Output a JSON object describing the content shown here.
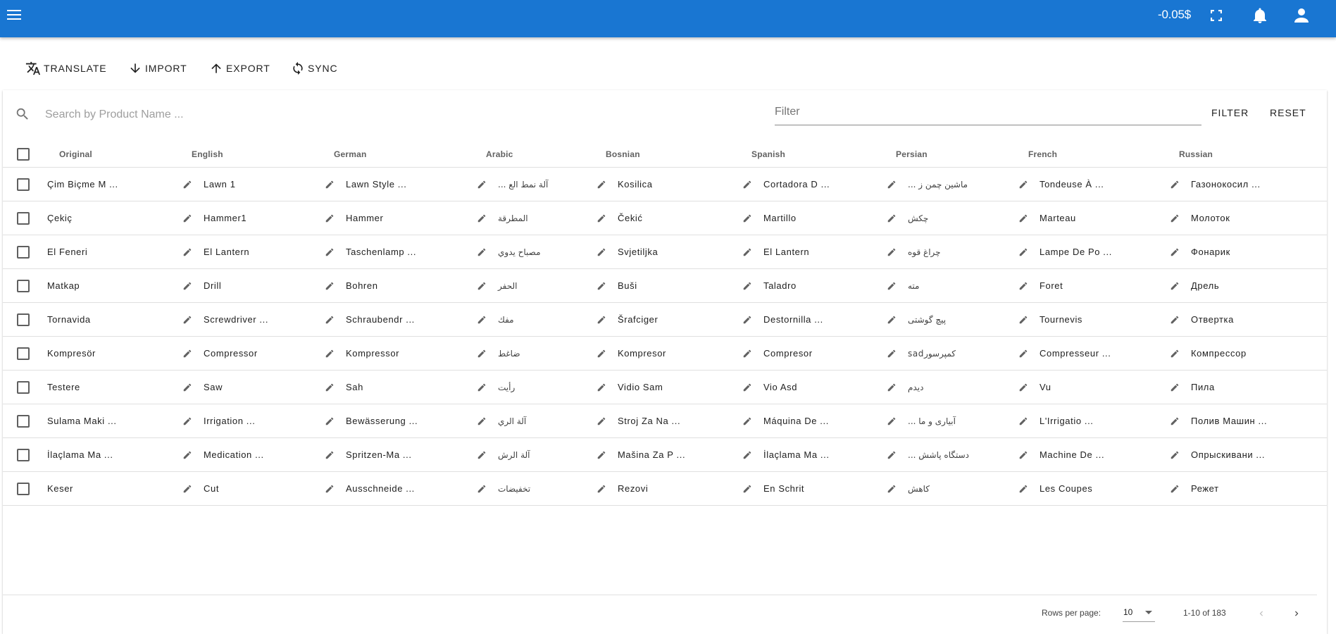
{
  "appbar": {
    "balance": "-0.05$",
    "bg_color": "#1976d2",
    "icons": [
      "menu-icon",
      "fullscreen-icon",
      "bell-icon",
      "account-icon"
    ]
  },
  "toolbar": {
    "translate_label": "TRANSLATE",
    "import_label": "IMPORT",
    "export_label": "EXPORT",
    "sync_label": "SYNC"
  },
  "search": {
    "placeholder": "Search by Product Name ...",
    "value": ""
  },
  "filter": {
    "placeholder": "Filter",
    "value": "",
    "filter_label": "FILTER",
    "reset_label": "RESET"
  },
  "table": {
    "columns": [
      "Original",
      "English",
      "German",
      "Arabic",
      "Bosnian",
      "Spanish",
      "Persian",
      "French",
      "Russian"
    ],
    "rows": [
      [
        "Çim Biçme M ...",
        "Lawn 1",
        "Lawn Style ...",
        "آلة نمط الع ...",
        "Kosilica",
        "Cortadora D ...",
        "ماشین چمن ز ...",
        "Tondeuse À ...",
        "Газонокосил ..."
      ],
      [
        "Çekiç",
        "Hammer1",
        "Hammer",
        "المطرقة",
        "Čekić",
        "Martillo",
        "چکش",
        "Marteau",
        "Молоток"
      ],
      [
        "El Feneri",
        "El Lantern",
        "Taschenlamp ...",
        "مصباح يدوي",
        "Svjetiljka",
        "El Lantern",
        "چراغ قوه",
        "Lampe De Po ...",
        "Фонарик"
      ],
      [
        "Matkap",
        "Drill",
        "Bohren",
        "الحفر",
        "Buši",
        "Taladro",
        "مته",
        "Foret",
        "Дрель"
      ],
      [
        "Tornavida",
        "Screwdriver ...",
        "Schraubendr ...",
        "مفك",
        "Šrafciger",
        "Destornilla ...",
        "پیچ گوشتی",
        "Tournevis",
        "Отвертка"
      ],
      [
        "Kompresör",
        "Compressor",
        "Kompressor",
        "ضاغط",
        "Kompresor",
        "Compresor",
        "کمپرسورsad",
        "Compresseur ...",
        "Компрессор"
      ],
      [
        "Testere",
        "Saw",
        "Sah",
        "رأيت",
        "Vidio Sam",
        "Vio Asd",
        "دیدم",
        " Vu",
        "Пила"
      ],
      [
        "Sulama Maki ...",
        "Irrigation ...",
        "Bewässerung ...",
        "آلة الري",
        "Stroj Za Na ...",
        "Máquina De ...",
        "آبیاری و ما ...",
        "L'Irrigatio ...",
        "Полив Машин ..."
      ],
      [
        "İlaçlama Ma ...",
        "Medication ...",
        "Spritzen-Ma ...",
        "آلة الرش",
        "Mašina Za P ...",
        "İlaçlama Ma ...",
        "دستگاه پاشش ...",
        "Machine De ...",
        "Опрыскивани ..."
      ],
      [
        "Keser",
        "Cut",
        "Ausschneide ...",
        "تخفيضات",
        "Rezovi",
        "En Schrit",
        "کاهش",
        "Les Coupes",
        "Режет"
      ]
    ]
  },
  "pagination": {
    "rows_per_page_label": "Rows per page:",
    "rows_per_page_value": "10",
    "range_label": "1-10 of 183"
  }
}
